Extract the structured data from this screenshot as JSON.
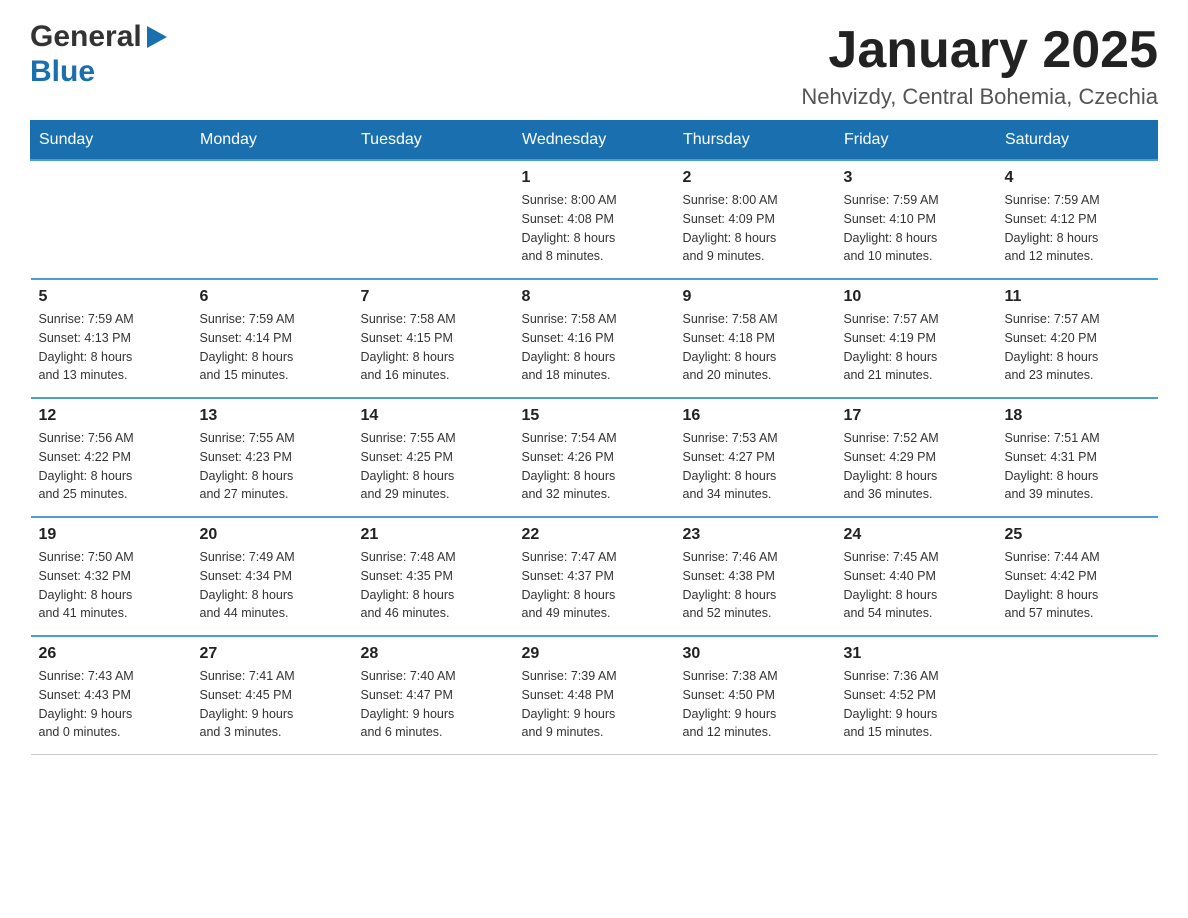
{
  "header": {
    "logo_general": "General",
    "logo_blue": "Blue",
    "title": "January 2025",
    "subtitle": "Nehvizdy, Central Bohemia, Czechia"
  },
  "days_of_week": [
    "Sunday",
    "Monday",
    "Tuesday",
    "Wednesday",
    "Thursday",
    "Friday",
    "Saturday"
  ],
  "weeks": [
    [
      {
        "day": "",
        "info": ""
      },
      {
        "day": "",
        "info": ""
      },
      {
        "day": "",
        "info": ""
      },
      {
        "day": "1",
        "info": "Sunrise: 8:00 AM\nSunset: 4:08 PM\nDaylight: 8 hours\nand 8 minutes."
      },
      {
        "day": "2",
        "info": "Sunrise: 8:00 AM\nSunset: 4:09 PM\nDaylight: 8 hours\nand 9 minutes."
      },
      {
        "day": "3",
        "info": "Sunrise: 7:59 AM\nSunset: 4:10 PM\nDaylight: 8 hours\nand 10 minutes."
      },
      {
        "day": "4",
        "info": "Sunrise: 7:59 AM\nSunset: 4:12 PM\nDaylight: 8 hours\nand 12 minutes."
      }
    ],
    [
      {
        "day": "5",
        "info": "Sunrise: 7:59 AM\nSunset: 4:13 PM\nDaylight: 8 hours\nand 13 minutes."
      },
      {
        "day": "6",
        "info": "Sunrise: 7:59 AM\nSunset: 4:14 PM\nDaylight: 8 hours\nand 15 minutes."
      },
      {
        "day": "7",
        "info": "Sunrise: 7:58 AM\nSunset: 4:15 PM\nDaylight: 8 hours\nand 16 minutes."
      },
      {
        "day": "8",
        "info": "Sunrise: 7:58 AM\nSunset: 4:16 PM\nDaylight: 8 hours\nand 18 minutes."
      },
      {
        "day": "9",
        "info": "Sunrise: 7:58 AM\nSunset: 4:18 PM\nDaylight: 8 hours\nand 20 minutes."
      },
      {
        "day": "10",
        "info": "Sunrise: 7:57 AM\nSunset: 4:19 PM\nDaylight: 8 hours\nand 21 minutes."
      },
      {
        "day": "11",
        "info": "Sunrise: 7:57 AM\nSunset: 4:20 PM\nDaylight: 8 hours\nand 23 minutes."
      }
    ],
    [
      {
        "day": "12",
        "info": "Sunrise: 7:56 AM\nSunset: 4:22 PM\nDaylight: 8 hours\nand 25 minutes."
      },
      {
        "day": "13",
        "info": "Sunrise: 7:55 AM\nSunset: 4:23 PM\nDaylight: 8 hours\nand 27 minutes."
      },
      {
        "day": "14",
        "info": "Sunrise: 7:55 AM\nSunset: 4:25 PM\nDaylight: 8 hours\nand 29 minutes."
      },
      {
        "day": "15",
        "info": "Sunrise: 7:54 AM\nSunset: 4:26 PM\nDaylight: 8 hours\nand 32 minutes."
      },
      {
        "day": "16",
        "info": "Sunrise: 7:53 AM\nSunset: 4:27 PM\nDaylight: 8 hours\nand 34 minutes."
      },
      {
        "day": "17",
        "info": "Sunrise: 7:52 AM\nSunset: 4:29 PM\nDaylight: 8 hours\nand 36 minutes."
      },
      {
        "day": "18",
        "info": "Sunrise: 7:51 AM\nSunset: 4:31 PM\nDaylight: 8 hours\nand 39 minutes."
      }
    ],
    [
      {
        "day": "19",
        "info": "Sunrise: 7:50 AM\nSunset: 4:32 PM\nDaylight: 8 hours\nand 41 minutes."
      },
      {
        "day": "20",
        "info": "Sunrise: 7:49 AM\nSunset: 4:34 PM\nDaylight: 8 hours\nand 44 minutes."
      },
      {
        "day": "21",
        "info": "Sunrise: 7:48 AM\nSunset: 4:35 PM\nDaylight: 8 hours\nand 46 minutes."
      },
      {
        "day": "22",
        "info": "Sunrise: 7:47 AM\nSunset: 4:37 PM\nDaylight: 8 hours\nand 49 minutes."
      },
      {
        "day": "23",
        "info": "Sunrise: 7:46 AM\nSunset: 4:38 PM\nDaylight: 8 hours\nand 52 minutes."
      },
      {
        "day": "24",
        "info": "Sunrise: 7:45 AM\nSunset: 4:40 PM\nDaylight: 8 hours\nand 54 minutes."
      },
      {
        "day": "25",
        "info": "Sunrise: 7:44 AM\nSunset: 4:42 PM\nDaylight: 8 hours\nand 57 minutes."
      }
    ],
    [
      {
        "day": "26",
        "info": "Sunrise: 7:43 AM\nSunset: 4:43 PM\nDaylight: 9 hours\nand 0 minutes."
      },
      {
        "day": "27",
        "info": "Sunrise: 7:41 AM\nSunset: 4:45 PM\nDaylight: 9 hours\nand 3 minutes."
      },
      {
        "day": "28",
        "info": "Sunrise: 7:40 AM\nSunset: 4:47 PM\nDaylight: 9 hours\nand 6 minutes."
      },
      {
        "day": "29",
        "info": "Sunrise: 7:39 AM\nSunset: 4:48 PM\nDaylight: 9 hours\nand 9 minutes."
      },
      {
        "day": "30",
        "info": "Sunrise: 7:38 AM\nSunset: 4:50 PM\nDaylight: 9 hours\nand 12 minutes."
      },
      {
        "day": "31",
        "info": "Sunrise: 7:36 AM\nSunset: 4:52 PM\nDaylight: 9 hours\nand 15 minutes."
      },
      {
        "day": "",
        "info": ""
      }
    ]
  ],
  "colors": {
    "header_bg": "#1a6faf",
    "header_text": "#ffffff",
    "border_top": "#4a9fd4"
  }
}
